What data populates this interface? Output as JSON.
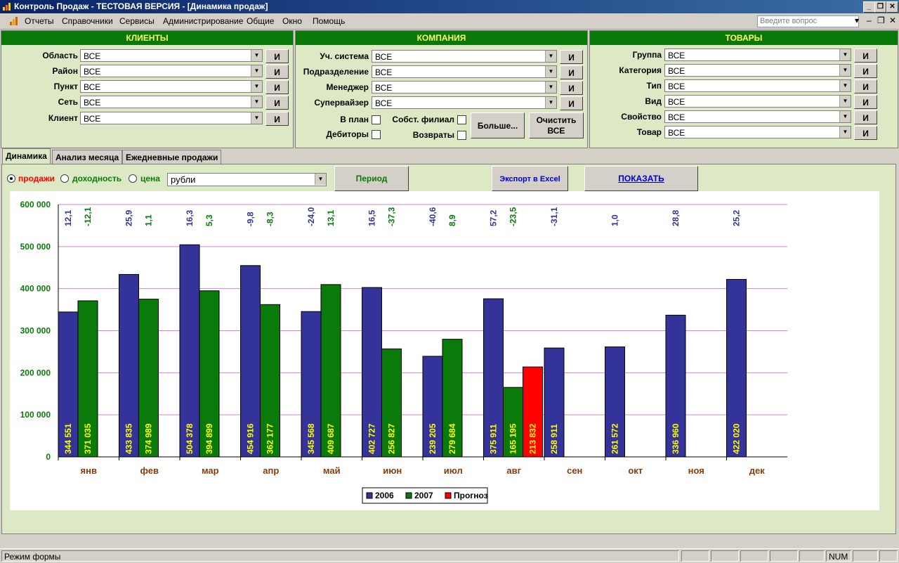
{
  "window": {
    "title": "Контроль Продаж - ТЕСТОВАЯ ВЕРСИЯ - [Динамика продаж]",
    "icon": "bar-chart-icon",
    "btn_min": "_",
    "btn_restore": "❐",
    "btn_close": "✕"
  },
  "menu": {
    "items": [
      "Отчеты",
      "Справочники",
      "Сервисы",
      "Администрирование",
      "Общие",
      "Окно",
      "Помощь"
    ],
    "ask_placeholder": "Введите вопрос",
    "ask_arrow": "▾",
    "child_min": "–",
    "child_restore": "❐",
    "child_close": "✕"
  },
  "clients": {
    "header": "КЛИЕНТЫ",
    "fields": [
      {
        "label": "Область",
        "value": "ВСЕ",
        "btn": "И"
      },
      {
        "label": "Район",
        "value": "ВСЕ",
        "btn": "И"
      },
      {
        "label": "Пункт",
        "value": "ВСЕ",
        "btn": "И"
      },
      {
        "label": "Сеть",
        "value": "ВСЕ",
        "btn": "И"
      },
      {
        "label": "Клиент",
        "value": "ВСЕ",
        "btn": "И"
      }
    ]
  },
  "company": {
    "header": "КОМПАНИЯ",
    "fields": [
      {
        "label": "Уч. система",
        "value": "ВСЕ",
        "btn": "И"
      },
      {
        "label": "Подразделение",
        "value": "ВСЕ",
        "btn": "И"
      },
      {
        "label": "Менеджер",
        "value": "ВСЕ",
        "btn": "И"
      },
      {
        "label": "Супервайзер",
        "value": "ВСЕ",
        "btn": "И"
      }
    ],
    "check_plan": "В план",
    "check_debtors": "Дебиторы",
    "check_branch": "Собст. филиал",
    "check_returns": "Возвраты",
    "more_btn": "Больше...",
    "clear_btn_l1": "Очистить",
    "clear_btn_l2": "ВСЕ"
  },
  "goods": {
    "header": "ТОВАРЫ",
    "fields": [
      {
        "label": "Группа",
        "value": "ВСЕ",
        "btn": "И"
      },
      {
        "label": "Категория",
        "value": "ВСЕ",
        "btn": "И"
      },
      {
        "label": "Тип",
        "value": "ВСЕ",
        "btn": "И"
      },
      {
        "label": "Вид",
        "value": "ВСЕ",
        "btn": "И"
      },
      {
        "label": "Свойство",
        "value": "ВСЕ",
        "btn": "И"
      },
      {
        "label": "Товар",
        "value": "ВСЕ",
        "btn": "И"
      }
    ]
  },
  "tabs": [
    "Динамика",
    "Анализ месяца",
    "Ежедневные продажи"
  ],
  "controls": {
    "radio_sales": "продажи",
    "radio_profit": "доходность",
    "radio_price": "цена",
    "unit_value": "рубли",
    "period_btn": "Период",
    "export_btn": "Экспорт в Excel",
    "show_btn": "ПОКАЗАТЬ"
  },
  "colors": {
    "s2006": "#333399",
    "s2007": "#0a7a0a",
    "forecast": "#ff0000",
    "value_label": "#ffff00",
    "month_label": "#8b3a0a",
    "axis_label": "#0a7a0a",
    "grid": "#cc88cc"
  },
  "chart_data": {
    "type": "bar",
    "categories": [
      "янв",
      "фев",
      "мар",
      "апр",
      "май",
      "июн",
      "июл",
      "авг",
      "сен",
      "окт",
      "ноя",
      "дек"
    ],
    "ylim": [
      0,
      600000
    ],
    "yticks": [
      "0",
      "100 000",
      "200 000",
      "300 000",
      "400 000",
      "500 000",
      "600 000"
    ],
    "series": [
      {
        "name": "2006",
        "values": [
          344551,
          433835,
          504378,
          454916,
          345568,
          402727,
          239205,
          375911,
          258911,
          261572,
          336960,
          422020
        ],
        "labels": [
          "344 551",
          "433 835",
          "504 378",
          "454 916",
          "345 568",
          "402 727",
          "239 205",
          "375 911",
          "258 911",
          "261 572",
          "336 960",
          "422 020"
        ],
        "pct": [
          "12,1",
          "25,9",
          "16,3",
          "-9,8",
          "-24,0",
          "16,5",
          "-40,6",
          "57,2",
          "-31,1",
          "1,0",
          "28,8",
          "25,2"
        ]
      },
      {
        "name": "2007",
        "values": [
          371035,
          374989,
          394899,
          362177,
          409687,
          256827,
          279684,
          165195,
          null,
          null,
          null,
          null
        ],
        "labels": [
          "371 035",
          "374 989",
          "394 899",
          "362 177",
          "409 687",
          "256 827",
          "279 684",
          "165 195",
          "",
          "",
          "",
          ""
        ],
        "pct": [
          "-12,1",
          "1,1",
          "5,3",
          "-8,3",
          "13,1",
          "-37,3",
          "8,9",
          "-23,5",
          "",
          "",
          "",
          ""
        ]
      },
      {
        "name": "Прогноз",
        "values": [
          null,
          null,
          null,
          null,
          null,
          null,
          null,
          213832,
          null,
          null,
          null,
          null
        ],
        "labels": [
          "",
          "",
          "",
          "",
          "",
          "",
          "",
          "213 832",
          "",
          "",
          "",
          ""
        ]
      }
    ],
    "legend_position": "bottom-center"
  },
  "status": {
    "mode": "Режим формы",
    "num": "NUM"
  }
}
